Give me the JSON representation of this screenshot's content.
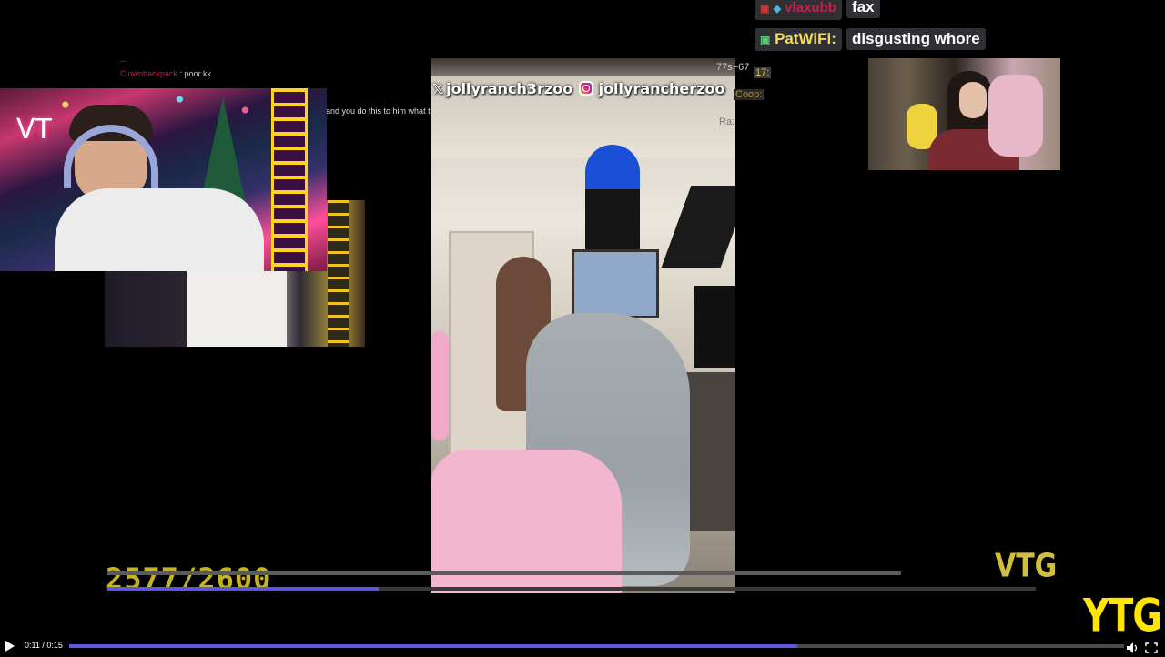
{
  "chat_top": [
    {
      "name": "vlaxubb",
      "message": "fax",
      "name_color": "#c1224a"
    },
    {
      "name": "PatWiFi:",
      "message": "disgusting whore",
      "name_color": "#f2d95b"
    }
  ],
  "left_chat": {
    "line0": "... ",
    "line1_user": "Clownbackpack",
    "line1_msg": ": poor kk",
    "line2": "and you do this to him what the"
  },
  "main_video": {
    "twitter_handle": "jollyranch3rzoo",
    "instagram_handle": "jollyrancherzoo",
    "overlay_chat": [
      "77s~67",
      "17:",
      "Coop:",
      "Ra:"
    ]
  },
  "counter_text": "2577/2600",
  "watermark_inner": "VTG",
  "watermark_outer": "YTG",
  "player": {
    "time": "0:11 / 0:15",
    "progress_fraction": 0.69,
    "accent": "#5b59d9"
  },
  "colors": {
    "background": "#000000",
    "pill_bg": "#2f3034",
    "watermark": "#ffe500"
  }
}
